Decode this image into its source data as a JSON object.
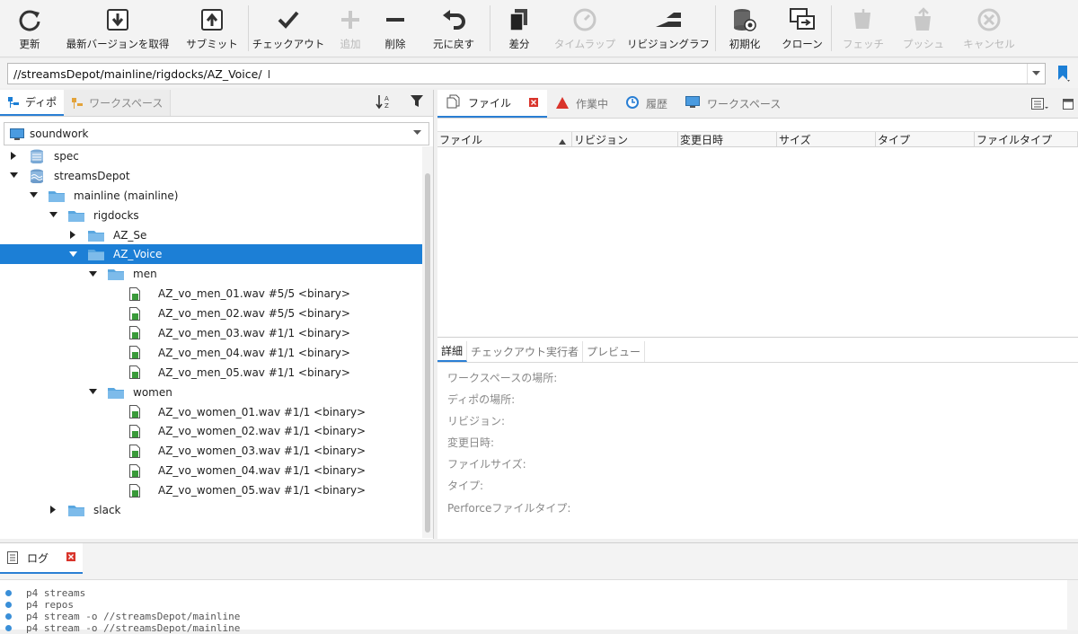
{
  "toolbar": {
    "buttons": [
      {
        "label": "更新",
        "icon": "refresh-icon"
      },
      {
        "label": "最新バージョンを取得",
        "icon": "get-latest-icon"
      },
      {
        "label": "サブミット",
        "icon": "submit-icon"
      },
      {
        "label": "チェックアウト",
        "icon": "checkmark-icon"
      },
      {
        "label": "追加",
        "icon": "plus-icon",
        "disabled": true
      },
      {
        "label": "削除",
        "icon": "minus-icon"
      },
      {
        "label": "元に戻す",
        "icon": "undo-icon"
      },
      {
        "label": "差分",
        "icon": "diff-icon"
      },
      {
        "label": "タイムラップ",
        "icon": "timelapse-icon",
        "disabled": true
      },
      {
        "label": "リビジョングラフ",
        "icon": "revision-graph-icon"
      },
      {
        "label": "初期化",
        "icon": "initialize-icon"
      },
      {
        "label": "クローン",
        "icon": "clone-icon"
      },
      {
        "label": "フェッチ",
        "icon": "fetch-icon",
        "disabled": true
      },
      {
        "label": "プッシュ",
        "icon": "push-icon",
        "disabled": true
      },
      {
        "label": "キャンセル",
        "icon": "cancel-icon",
        "disabled": true
      }
    ]
  },
  "path": {
    "value": "//streamsDepot/mainline/rigdocks/AZ_Voice/"
  },
  "left": {
    "tabs": [
      {
        "label": "ディポ"
      },
      {
        "label": "ワークスペース"
      }
    ],
    "workspace": "soundwork",
    "tree": [
      {
        "label": "spec",
        "level": 0,
        "expander": "collapsed",
        "icon": "spec-depot-icon"
      },
      {
        "label": "streamsDepot",
        "level": 0,
        "expander": "expanded",
        "icon": "stream-depot-icon"
      },
      {
        "label": "mainline (mainline)",
        "level": 1,
        "expander": "expanded",
        "icon": "folder-icon"
      },
      {
        "label": "rigdocks",
        "level": 2,
        "expander": "expanded",
        "icon": "folder-icon"
      },
      {
        "label": "AZ_Se",
        "level": 3,
        "expander": "collapsed",
        "icon": "folder-icon"
      },
      {
        "label": "AZ_Voice",
        "level": 3,
        "expander": "expanded",
        "icon": "folder-icon",
        "selected": true
      },
      {
        "label": "men",
        "level": 4,
        "expander": "expanded",
        "icon": "folder-icon"
      },
      {
        "label": "AZ_vo_men_01.wav #5/5 <binary>",
        "level": 5,
        "expander": "none",
        "icon": "file-icon"
      },
      {
        "label": "AZ_vo_men_02.wav #5/5 <binary>",
        "level": 5,
        "expander": "none",
        "icon": "file-icon"
      },
      {
        "label": "AZ_vo_men_03.wav #1/1 <binary>",
        "level": 5,
        "expander": "none",
        "icon": "file-icon"
      },
      {
        "label": "AZ_vo_men_04.wav #1/1 <binary>",
        "level": 5,
        "expander": "none",
        "icon": "file-icon"
      },
      {
        "label": "AZ_vo_men_05.wav #1/1 <binary>",
        "level": 5,
        "expander": "none",
        "icon": "file-icon"
      },
      {
        "label": "women",
        "level": 4,
        "expander": "expanded",
        "icon": "folder-icon"
      },
      {
        "label": "AZ_vo_women_01.wav #1/1 <binary>",
        "level": 5,
        "expander": "none",
        "icon": "file-icon"
      },
      {
        "label": "AZ_vo_women_02.wav #1/1 <binary>",
        "level": 5,
        "expander": "none",
        "icon": "file-icon"
      },
      {
        "label": "AZ_vo_women_03.wav #1/1 <binary>",
        "level": 5,
        "expander": "none",
        "icon": "file-icon"
      },
      {
        "label": "AZ_vo_women_04.wav #1/1 <binary>",
        "level": 5,
        "expander": "none",
        "icon": "file-icon"
      },
      {
        "label": "AZ_vo_women_05.wav #1/1 <binary>",
        "level": 5,
        "expander": "none",
        "icon": "file-icon"
      },
      {
        "label": "slack",
        "level": 2,
        "expander": "collapsed",
        "icon": "folder-icon"
      }
    ]
  },
  "right": {
    "tabs": [
      {
        "label": "ファイル",
        "icon": "files-icon",
        "active": true,
        "closable": true
      },
      {
        "label": "作業中",
        "icon": "pending-icon"
      },
      {
        "label": "履歴",
        "icon": "history-icon"
      },
      {
        "label": "ワークスペース",
        "icon": "monitor-icon"
      }
    ],
    "columns": [
      "ファイル",
      "リビジョン",
      "変更日時",
      "サイズ",
      "タイプ",
      "ファイルタイプ"
    ],
    "detail_tabs": [
      "詳細",
      "チェックアウト実行者",
      "プレビュー"
    ],
    "details": [
      "ワークスペースの場所:",
      "ディポの場所:",
      "リビジョン:",
      "変更日時:",
      "ファイルサイズ:",
      "タイプ:",
      "Perforceファイルタイプ:"
    ]
  },
  "log": {
    "tab_label": "ログ",
    "lines": [
      "p4 streams",
      "p4 repos",
      "p4 stream -o //streamsDepot/mainline",
      "p4 stream -o //streamsDepot/mainline"
    ]
  },
  "colors": {
    "accent": "#1c7fd6",
    "close": "#d9342b",
    "folder": "#5aa7e0"
  }
}
